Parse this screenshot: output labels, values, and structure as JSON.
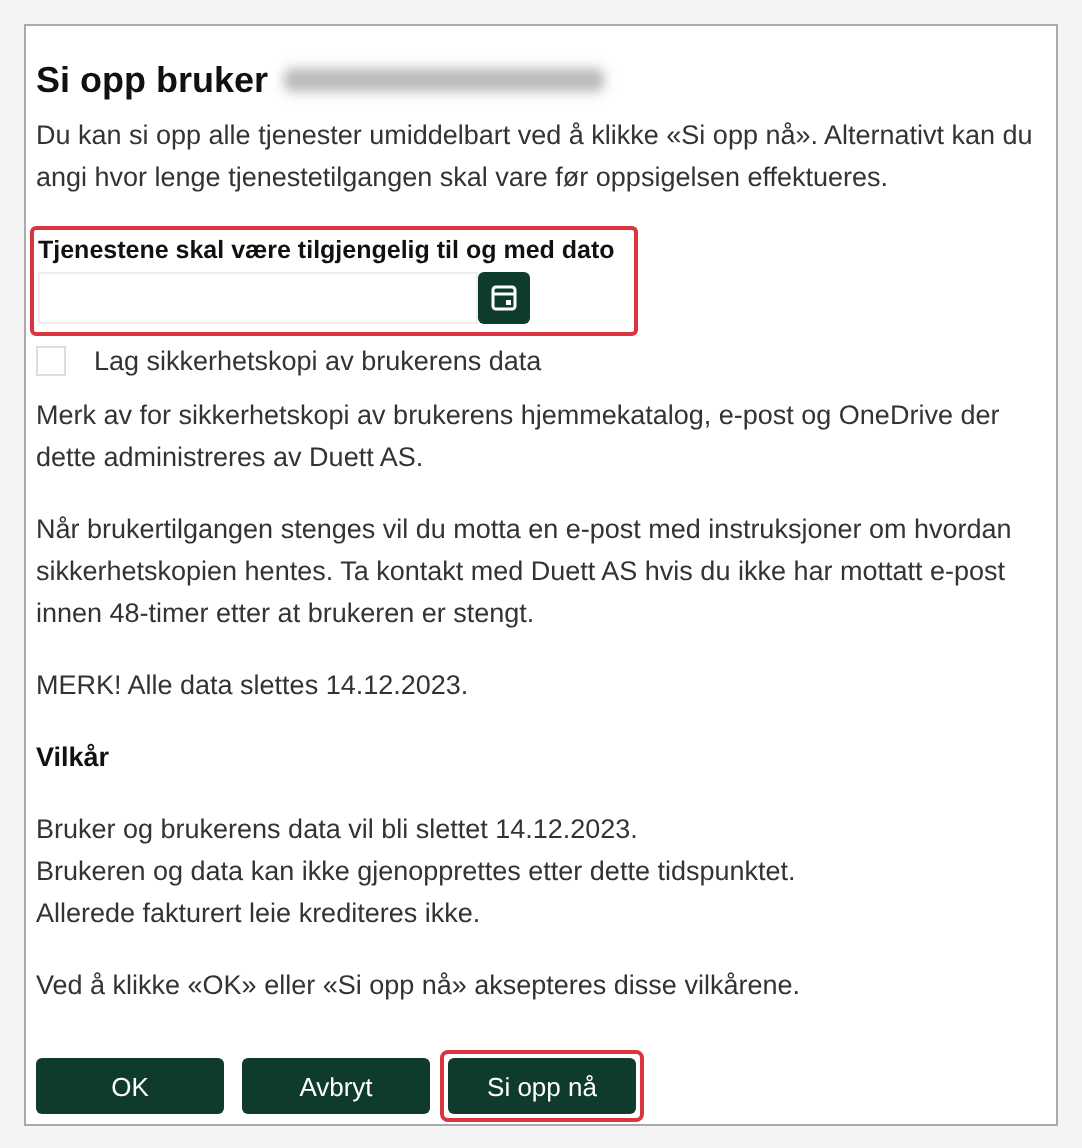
{
  "dialog": {
    "title": "Si opp bruker",
    "title_redacted": true,
    "intro": "Du kan si opp alle tjenester umiddelbart ved å klikke «Si opp nå». Alternativt kan du angi hvor lenge tjenestetilgangen skal vare før oppsigelsen effektueres.",
    "date_field": {
      "label": "Tjenestene skal være tilgjengelig til og med dato",
      "highlighted": true
    },
    "backup": {
      "label": "Lag sikkerhetskopi av brukerens data",
      "checked": false
    },
    "paragraphs": [
      {
        "kind": "text",
        "text": "Merk av for sikkerhetskopi av brukerens hjemmekatalog, e-post og OneDrive der dette administreres av Duett AS."
      },
      {
        "kind": "text",
        "text": "Når brukertilgangen stenges vil du motta en e-post med instruksjoner om hvordan sikkerhetskopien hentes. Ta kontakt med Duett AS hvis du ikke har mottatt e-post innen 48-timer etter at brukeren er stengt."
      },
      {
        "kind": "text",
        "text": "MERK! Alle data slettes 14.12.2023."
      },
      {
        "kind": "heading",
        "text": "Vilkår"
      },
      {
        "kind": "lines",
        "lines": [
          "Bruker og brukerens data vil bli slettet 14.12.2023.",
          "Brukeren og data kan ikke gjenopprettes etter dette tidspunktet.",
          "Allerede fakturert leie krediteres ikke."
        ]
      },
      {
        "kind": "text",
        "text": "Ved å klikke «OK» eller «Si opp nå» aksepteres disse vilkårene."
      }
    ],
    "buttons": [
      {
        "label": "OK",
        "highlighted": false
      },
      {
        "label": "Avbryt",
        "highlighted": false
      },
      {
        "label": "Si opp nå",
        "highlighted": true
      }
    ]
  }
}
